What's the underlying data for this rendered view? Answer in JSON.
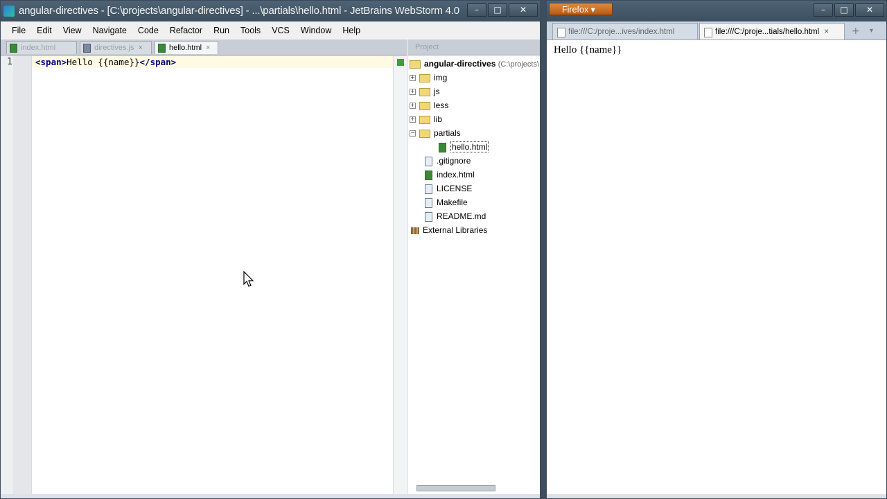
{
  "webstorm": {
    "title": "angular-directives - [C:\\projects\\angular-directives] - ...\\partials\\hello.html - JetBrains WebStorm 4.0",
    "menu": [
      "File",
      "Edit",
      "View",
      "Navigate",
      "Code",
      "Refactor",
      "Run",
      "Tools",
      "VCS",
      "Window",
      "Help"
    ],
    "tabs": [
      {
        "label": "index.html",
        "close": ""
      },
      {
        "label": "directives.js",
        "close": "×"
      },
      {
        "label": "hello.html",
        "close": "×"
      }
    ],
    "editor": {
      "line_number": "1",
      "code_open_tag": "<span>",
      "code_text": "Hello {{name}}",
      "code_close_tag": "</span>"
    },
    "project_panel": {
      "header": "Project",
      "root": "angular-directives",
      "root_path": "(C:\\projects\\",
      "items": [
        {
          "label": "img",
          "kind": "folder"
        },
        {
          "label": "js",
          "kind": "folder"
        },
        {
          "label": "less",
          "kind": "folder"
        },
        {
          "label": "lib",
          "kind": "folder"
        },
        {
          "label": "partials",
          "kind": "folder"
        },
        {
          "label": "hello.html",
          "kind": "html"
        },
        {
          "label": ".gitignore",
          "kind": "file"
        },
        {
          "label": "index.html",
          "kind": "html"
        },
        {
          "label": "LICENSE",
          "kind": "file"
        },
        {
          "label": "Makefile",
          "kind": "file"
        },
        {
          "label": "README.md",
          "kind": "file"
        }
      ],
      "external": "External Libraries"
    }
  },
  "firefox": {
    "button": "Firefox",
    "tabs": [
      {
        "label": "file:///C:/proje...ives/index.html"
      },
      {
        "label": "file:///C:/proje...tials/hello.html",
        "close": "×"
      }
    ],
    "new_tab": "+",
    "content": "Hello {{name}}"
  },
  "window_controls": {
    "minimize": "–",
    "maximize": "□",
    "close": "✕"
  }
}
